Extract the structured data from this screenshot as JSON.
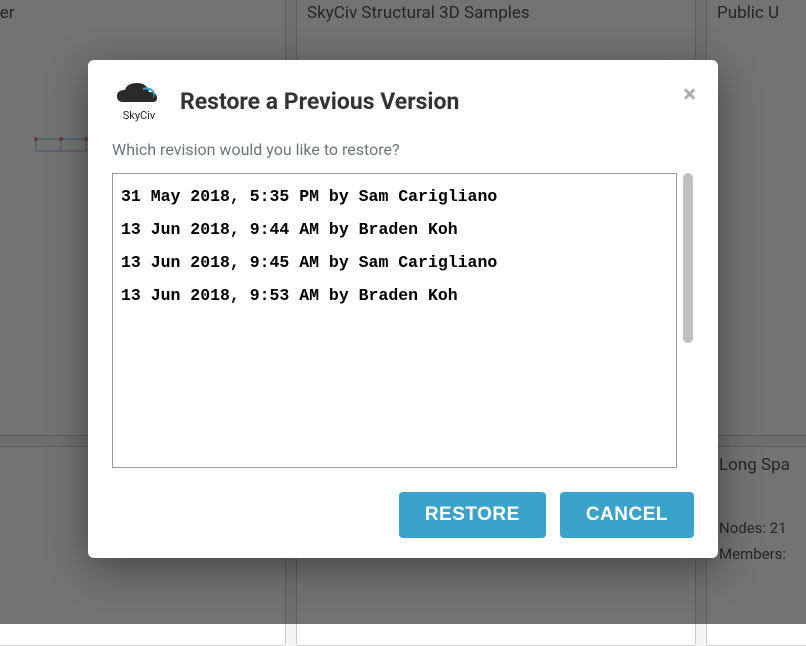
{
  "background": {
    "tiles": [
      {
        "title": "ducation Folder"
      },
      {
        "title": "SkyCiv Structural 3D Samples"
      },
      {
        "title": "Public U"
      },
      {
        "title": ""
      },
      {
        "title": ""
      },
      {
        "title": "Long Spa",
        "nodes": "Nodes: 21",
        "members": "Members:"
      }
    ],
    "meta8": "8"
  },
  "modal": {
    "logo_text": "SkyCiv",
    "title": "Restore a Previous Version",
    "prompt": "Which revision would you like to restore?",
    "revisions": [
      "31 May 2018, 5:35 PM by Sam Carigliano",
      "13 Jun 2018, 9:44 AM by Braden Koh",
      "13 Jun 2018, 9:45 AM by Sam Carigliano",
      "13 Jun 2018, 9:53 AM by Braden Koh"
    ],
    "restore_label": "RESTORE",
    "cancel_label": "CANCEL",
    "close_label": "×"
  }
}
